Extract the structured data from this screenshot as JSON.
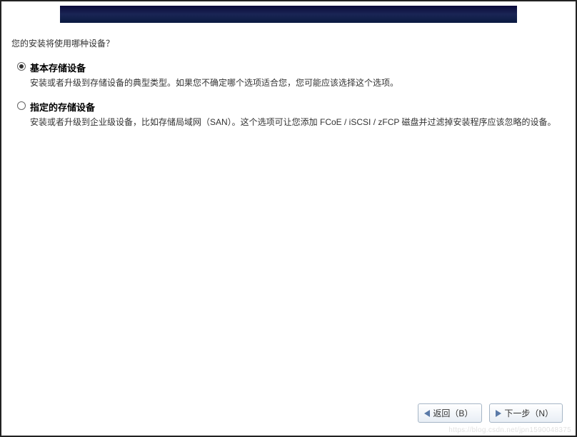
{
  "question": "您的安装将使用哪种设备？",
  "options": [
    {
      "title": "基本存储设备",
      "desc": "安装或者升级到存储设备的典型类型。如果您不确定哪个选项适合您，您可能应该选择这个选项。",
      "selected": true
    },
    {
      "title": "指定的存储设备",
      "desc": "安装或者升级到企业级设备，比如存储局域网（SAN）。这个选项可让您添加 FCoE / iSCSI / zFCP 磁盘并过滤掉安装程序应该忽略的设备。",
      "selected": false
    }
  ],
  "buttons": {
    "back": "返回（B）",
    "next": "下一步（N）"
  },
  "watermark": "https://blog.csdn.net/jpn1590048375"
}
